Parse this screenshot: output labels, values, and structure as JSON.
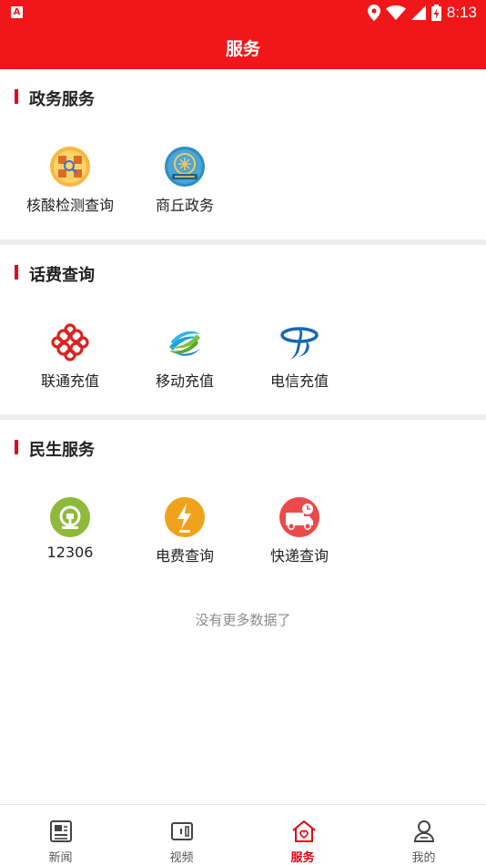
{
  "status_bar": {
    "time": "8:13",
    "app_icon": "A"
  },
  "header": {
    "title": "服务"
  },
  "sections": [
    {
      "title": "政务服务",
      "items": [
        {
          "label": "核酸检测查询",
          "icon": "nucleic-test-icon"
        },
        {
          "label": "商丘政务",
          "icon": "shangqiu-gov-icon"
        }
      ]
    },
    {
      "title": "话费查询",
      "items": [
        {
          "label": "联通充值",
          "icon": "china-unicom-icon"
        },
        {
          "label": "移动充值",
          "icon": "china-mobile-icon"
        },
        {
          "label": "电信充值",
          "icon": "china-telecom-icon"
        }
      ]
    },
    {
      "title": "民生服务",
      "items": [
        {
          "label": "12306",
          "icon": "railway-12306-icon"
        },
        {
          "label": "电费查询",
          "icon": "electricity-bill-icon"
        },
        {
          "label": "快递查询",
          "icon": "express-delivery-icon"
        }
      ]
    }
  ],
  "footer_note": "没有更多数据了",
  "tabs": [
    {
      "label": "新闻",
      "icon": "news-icon"
    },
    {
      "label": "视频",
      "icon": "video-icon"
    },
    {
      "label": "服务",
      "icon": "service-icon",
      "active": true
    },
    {
      "label": "我的",
      "icon": "profile-icon"
    }
  ],
  "colors": {
    "brand_red": "#f0161a",
    "accent_red": "#e60012"
  }
}
